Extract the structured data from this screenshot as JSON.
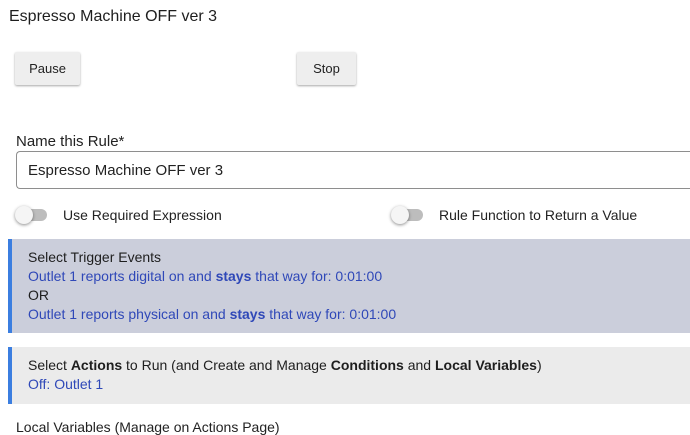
{
  "page": {
    "title": "Espresso Machine OFF ver 3"
  },
  "controls": {
    "pause_label": "Pause",
    "stop_label": "Stop"
  },
  "rule_name": {
    "label": "Name this Rule*",
    "value": "Espresso Machine OFF ver 3"
  },
  "toggles": [
    {
      "label": "Use Required Expression",
      "on": false
    },
    {
      "label": "Rule Function to Return a Value",
      "on": false
    }
  ],
  "triggers": {
    "heading": "Select Trigger Events",
    "events": [
      {
        "prefix": "Outlet 1 reports digital on and ",
        "bold": "stays",
        "suffix": " that way for: 0:01:00"
      },
      {
        "prefix": "Outlet 1 reports physical on and ",
        "bold": "stays",
        "suffix": " that way for: 0:01:00"
      }
    ],
    "separator": "OR"
  },
  "actions": {
    "heading_parts": [
      "Select ",
      "Actions",
      " to Run (and Create and Manage ",
      "Conditions",
      " and ",
      "Local Variables",
      ")"
    ],
    "summary": "Off: Outlet 1"
  },
  "local_variables": {
    "title": "Local Variables",
    "note": " (Manage on Actions Page)"
  },
  "colors": {
    "accent": "#3b7ee0",
    "link": "#2f48b8",
    "trigger_panel_bg": "#cbcedb",
    "action_panel_bg": "#ebebeb"
  }
}
